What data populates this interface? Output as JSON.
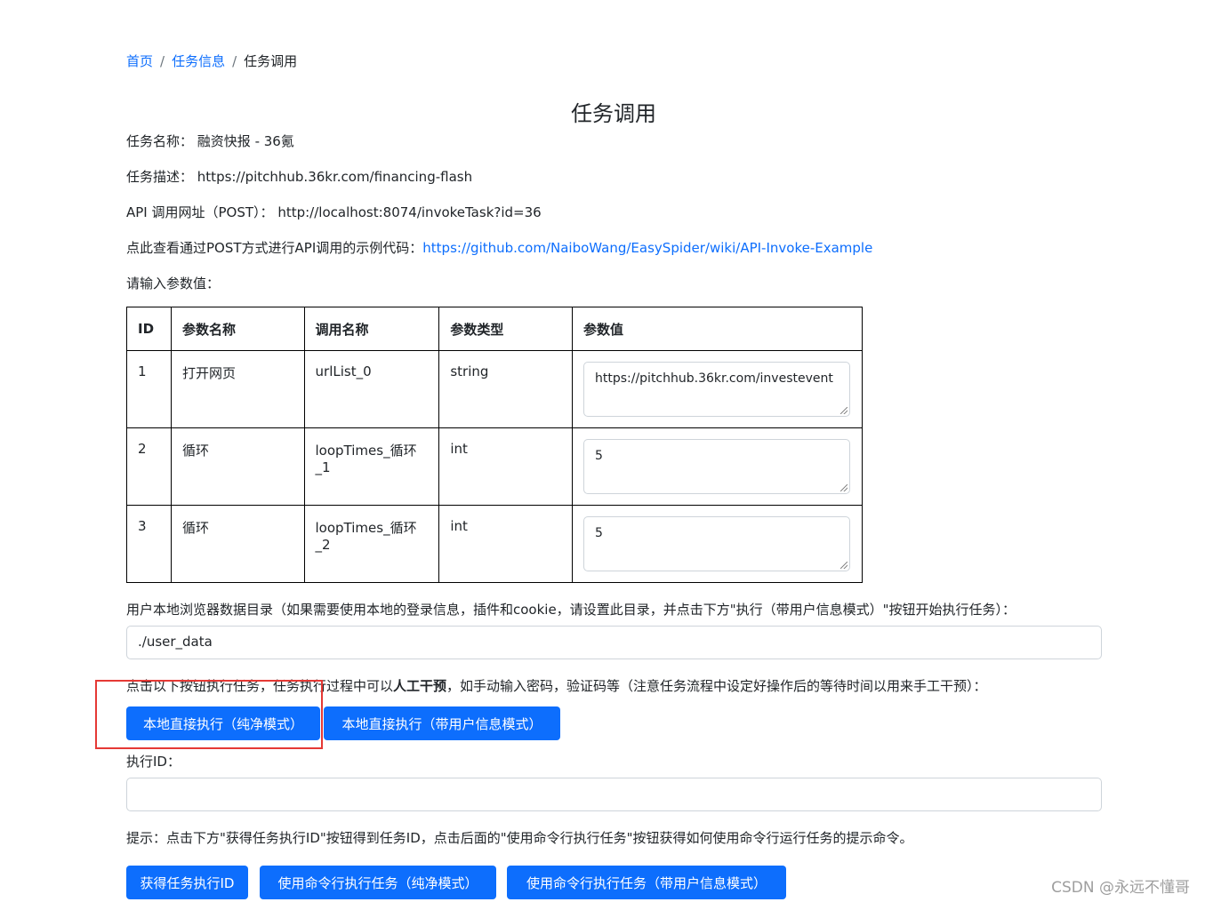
{
  "breadcrumb": {
    "home": "首页",
    "task_info": "任务信息",
    "current": "任务调用",
    "separator": "/"
  },
  "page_title": "任务调用",
  "task": {
    "name_label": "任务名称：",
    "name": "融资快报 - 36氪",
    "desc_label": "任务描述：",
    "desc": "https://pitchhub.36kr.com/financing-flash",
    "api_label": "API 调用网址（POST）：",
    "api_url": "http://localhost:8074/invokeTask?id=36",
    "example_label": "点此查看通过POST方式进行API调用的示例代码：",
    "example_link": "https://github.com/NaiboWang/EasySpider/wiki/API-Invoke-Example",
    "params_prompt": "请输入参数值："
  },
  "table": {
    "headers": [
      "ID",
      "参数名称",
      "调用名称",
      "参数类型",
      "参数值"
    ],
    "rows": [
      {
        "id": "1",
        "name": "打开网页",
        "call_name": "urlList_0",
        "type": "string",
        "value": "https://pitchhub.36kr.com/investevent"
      },
      {
        "id": "2",
        "name": "循环",
        "call_name": "loopTimes_循环_1",
        "type": "int",
        "value": "5"
      },
      {
        "id": "3",
        "name": "循环",
        "call_name": "loopTimes_循环_2",
        "type": "int",
        "value": "5"
      }
    ]
  },
  "user_data": {
    "label": "用户本地浏览器数据目录（如果需要使用本地的登录信息，插件和cookie，请设置此目录，并点击下方\"执行（带用户信息模式）\"按钮开始执行任务）：",
    "value": "./user_data"
  },
  "exec_hint": {
    "part1": "点击以下按钮执行任务，任务执行过程中可以",
    "bold": "人工干预",
    "part2": "，如手动输入密码，验证码等（注意任务流程中设定好操作后的等待时间以用来手工干预）："
  },
  "buttons": {
    "run_clean": "本地直接执行（纯净模式）",
    "run_user": "本地直接执行（带用户信息模式）",
    "get_id": "获得任务执行ID",
    "cmd_clean": "使用命令行执行任务（纯净模式）",
    "cmd_user": "使用命令行执行任务（带用户信息模式）"
  },
  "exec_id": {
    "label": "执行ID：",
    "value": ""
  },
  "tip": "提示：点击下方\"获得任务执行ID\"按钮得到任务ID，点击后面的\"使用命令行执行任务\"按钮获得如何使用命令行运行任务的提示命令。",
  "watermark": "CSDN @永远不懂哥",
  "colors": {
    "primary": "#0d6efd",
    "highlight": "#e53935",
    "border": "#ced4da"
  }
}
